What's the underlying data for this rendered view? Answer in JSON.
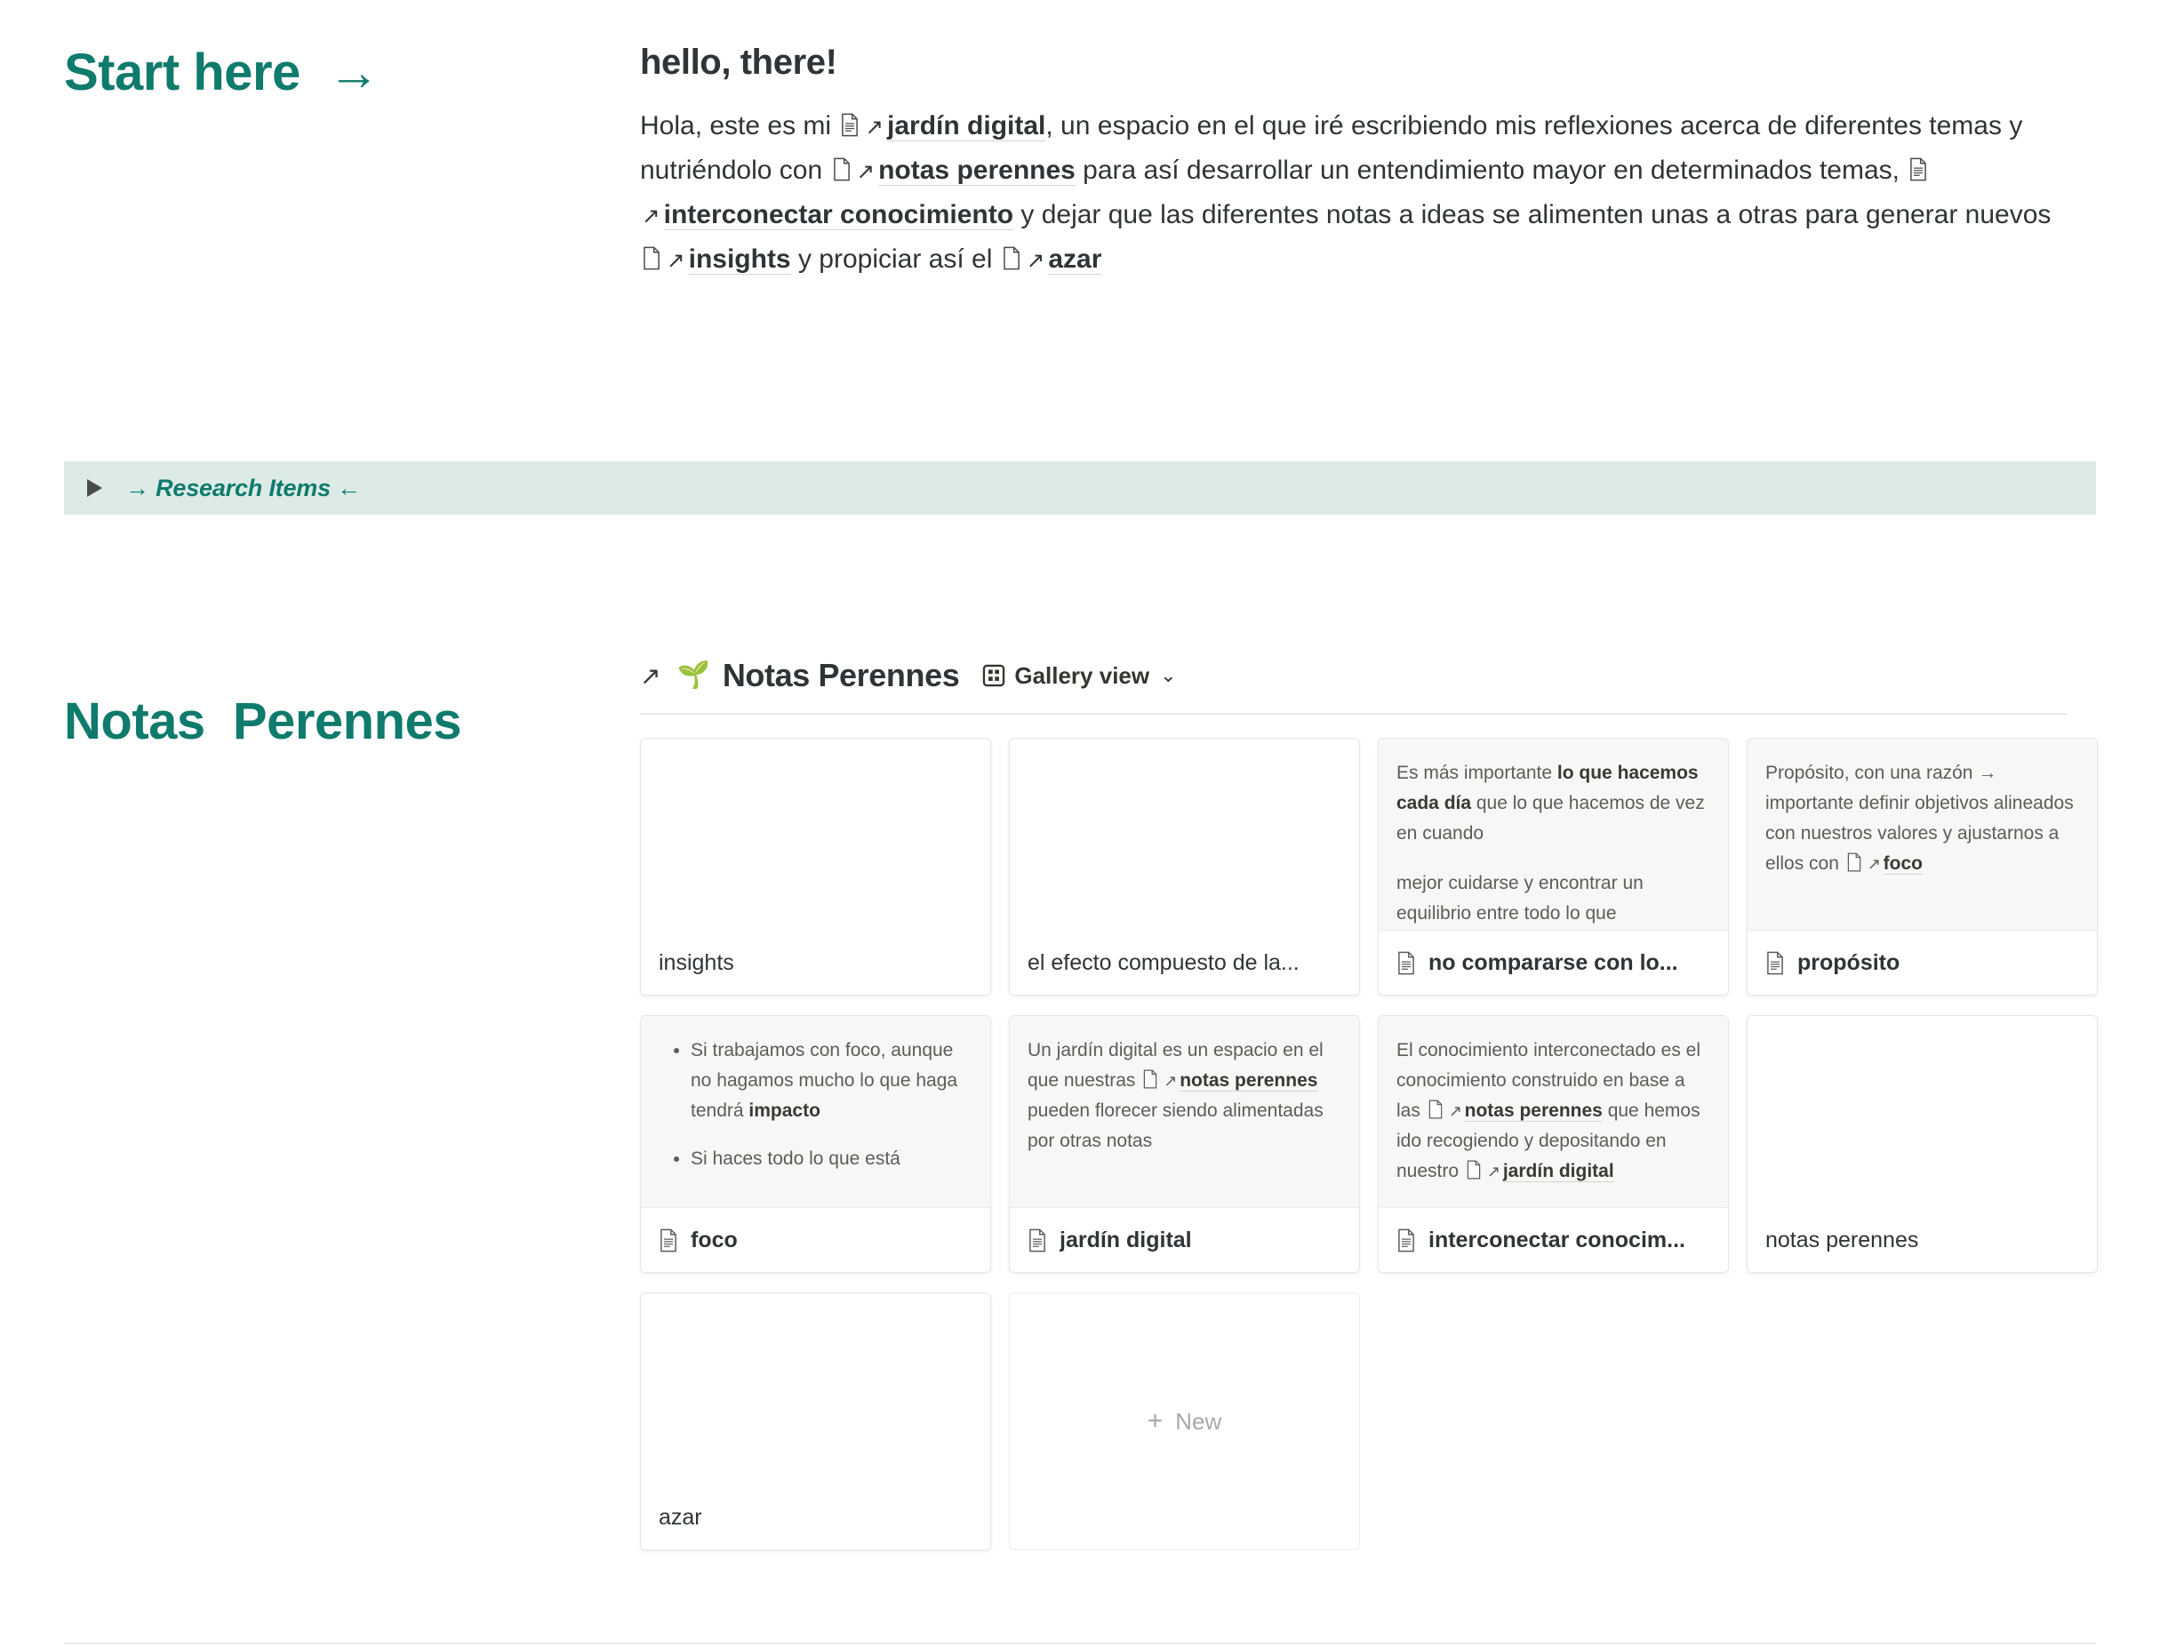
{
  "intro": {
    "left_heading": "Start here  →",
    "title": "hello, there!",
    "paragraph": {
      "seg1": "Hola, este es mi ",
      "link1": "jardín digital",
      "seg2": ", un espacio en el que iré escribiendo mis reflexiones acerca de diferentes temas y nutriéndolo con ",
      "link2": "notas perennes",
      "seg3": " para así desarrollar un entendimiento mayor en determinados temas, ",
      "link3": "interconectar conocimiento",
      "seg4": " y dejar que las diferentes notas a ideas se alimenten unas a otras para generar nuevos ",
      "link4": "insights",
      "seg5": " y propiciar así el ",
      "link5": "azar"
    }
  },
  "toggle": {
    "label": "→ Research Items ←",
    "triangle_icon": "triangle-right-icon",
    "background_color": "#ddebe7",
    "text_color": "#0f7b6c"
  },
  "gallery": {
    "left_heading": "Notas  Perennes",
    "open_arrow_icon": "open-external-arrow-icon",
    "db_emoji": "🌱",
    "db_title": "Notas Perennes",
    "view_icon": "gallery-grid-icon",
    "view_label": "Gallery view",
    "chevron_icon": "chevron-down-icon",
    "new_card_label": "New",
    "new_card_plus": "+",
    "cards": [
      {
        "title": "insights",
        "has_icon": false,
        "empty": true,
        "preview": []
      },
      {
        "title": "el efecto compuesto de la...",
        "has_icon": false,
        "empty": true,
        "preview": []
      },
      {
        "title": "no compararse con lo...",
        "has_icon": true,
        "empty": false,
        "preview": [
          {
            "type": "paragraph",
            "parts": [
              {
                "kind": "text",
                "text": "Es más importante "
              },
              {
                "kind": "bold",
                "text": "lo que hacemos cada día"
              },
              {
                "kind": "text",
                "text": " que lo que hacemos de vez en cuando"
              }
            ]
          },
          {
            "type": "paragraph",
            "parts": [
              {
                "kind": "text",
                "text": "mejor cuidarse y encontrar un equilibrio entre todo lo que"
              }
            ]
          }
        ]
      },
      {
        "title": "propósito",
        "has_icon": true,
        "empty": false,
        "preview": [
          {
            "type": "paragraph",
            "parts": [
              {
                "kind": "text",
                "text": "Propósito, con una razón → importante definir objetivos alineados con nuestros valores y ajustarnos a ellos con "
              },
              {
                "kind": "link",
                "text": "foco"
              }
            ]
          }
        ]
      },
      {
        "title": "foco",
        "has_icon": true,
        "empty": false,
        "preview": [
          {
            "type": "bullets",
            "items": [
              [
                {
                  "kind": "text",
                  "text": "Si trabajamos con foco, aunque no hagamos mucho lo que haga tendrá "
                },
                {
                  "kind": "bold",
                  "text": "impacto"
                }
              ],
              [
                {
                  "kind": "text",
                  "text": "Si haces todo lo que está"
                }
              ]
            ]
          }
        ]
      },
      {
        "title": "jardín digital",
        "has_icon": true,
        "empty": false,
        "preview": [
          {
            "type": "paragraph",
            "parts": [
              {
                "kind": "text",
                "text": "Un jardín digital es un espacio en el que nuestras "
              },
              {
                "kind": "link",
                "text": "notas perennes"
              },
              {
                "kind": "text",
                "text": " pueden florecer siendo alimentadas por otras notas"
              }
            ]
          }
        ]
      },
      {
        "title": "interconectar conocim...",
        "has_icon": true,
        "empty": false,
        "preview": [
          {
            "type": "paragraph",
            "parts": [
              {
                "kind": "text",
                "text": "El conocimiento interconectado es el conocimiento construido en base a las "
              },
              {
                "kind": "link",
                "text": "notas perennes"
              },
              {
                "kind": "text",
                "text": " que hemos ido recogiendo y depositando en nuestro "
              },
              {
                "kind": "link",
                "text": "jardín digital"
              }
            ]
          }
        ]
      },
      {
        "title": "notas perennes",
        "has_icon": false,
        "empty": true,
        "preview": []
      },
      {
        "title": "azar",
        "has_icon": false,
        "empty": true,
        "preview": []
      }
    ]
  },
  "colors": {
    "accent_teal": "#0f7b6c",
    "band_mint": "#ddebe7",
    "card_preview_gray": "#f7f7f5",
    "text_primary": "#2f3437",
    "text_muted": "#5d5c59"
  }
}
